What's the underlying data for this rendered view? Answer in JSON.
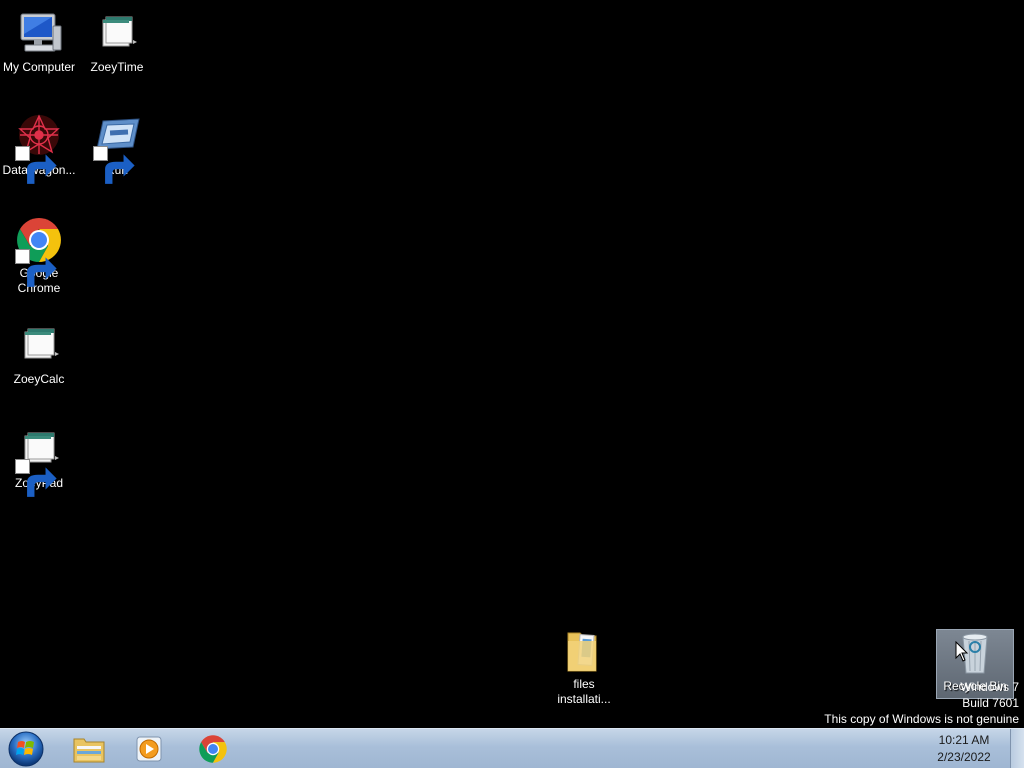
{
  "desktop": {
    "icons": [
      {
        "label": "My Computer"
      },
      {
        "label": "ZoeyTime"
      },
      {
        "label": "DataWagon..."
      },
      {
        "label": "Run"
      },
      {
        "label": "Google Chrome"
      },
      {
        "label": "ZoeyCalc"
      },
      {
        "label": "ZoeyPad"
      },
      {
        "label": "files installati..."
      },
      {
        "label": "Recycle Bin"
      }
    ],
    "watermark": {
      "line1": "Windows 7",
      "line2": "Build 7601",
      "line3": "This copy of Windows is not genuine"
    }
  },
  "taskbar": {
    "pinned": [
      {
        "icon": "folder-icon"
      },
      {
        "icon": "media-player-icon"
      },
      {
        "icon": "chrome-icon"
      }
    ],
    "clock": {
      "time": "10:21 AM",
      "date": "2/23/2022"
    }
  },
  "colors": {
    "desktop_bg": "#000000",
    "taskbar_bg": "#a9bfd9",
    "selection": "#6e7884"
  }
}
